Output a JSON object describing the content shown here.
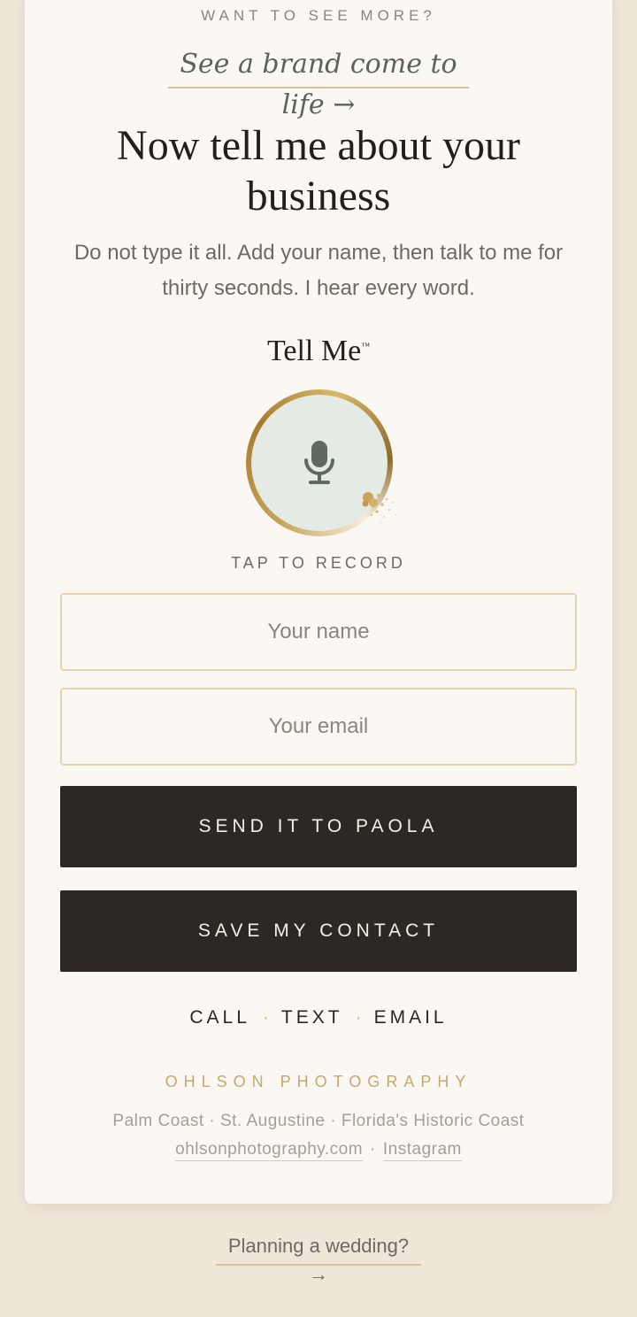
{
  "header": {
    "eyebrow": "WANT TO SEE MORE?",
    "brand_link": "See a brand come to life →"
  },
  "intro": {
    "title_line1": "Now tell me about your",
    "title_line2": "business",
    "subtitle_line1": "Do not type it all. Add your name, then talk to me for",
    "subtitle_line2": "thirty seconds. I hear every word."
  },
  "recorder": {
    "label": "Tell Me",
    "trademark": "™",
    "icon": "microphone-icon",
    "tap_label": "TAP TO RECORD"
  },
  "form": {
    "name_placeholder": "Your name",
    "email_placeholder": "Your email",
    "send_label": "SEND IT TO PAOLA",
    "save_label": "SAVE MY CONTACT"
  },
  "contact": {
    "call": "CALL",
    "text": "TEXT",
    "email": "EMAIL",
    "separator": "·"
  },
  "footer": {
    "studio": "OHLSON PHOTOGRAPHY",
    "locations": "Palm Coast · St. Augustine · Florida's Historic Coast",
    "website": "ohlsonphotography.com",
    "separator": "·",
    "instagram": "Instagram"
  },
  "wedding_link": "Planning a wedding? →",
  "colors": {
    "page_bg": "#efe6da",
    "card_bg": "#fbf8f3",
    "button_bg": "#2d2826",
    "accent_gold": "#c6a86e",
    "mic_bg": "#e4ebe5"
  }
}
